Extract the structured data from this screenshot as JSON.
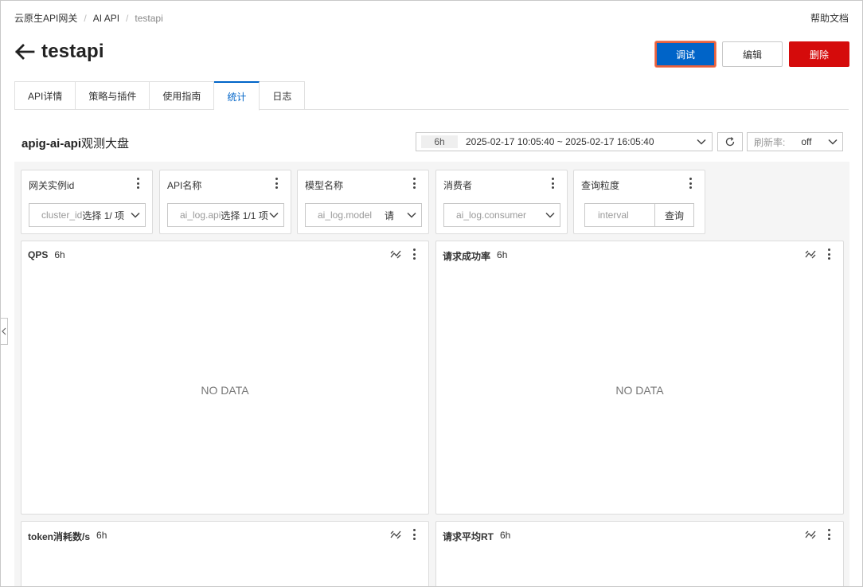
{
  "breadcrumb": {
    "items": [
      "云原生API网关",
      "AI API",
      "testapi"
    ],
    "separator": "/"
  },
  "help_link": "帮助文档",
  "page": {
    "title": "testapi",
    "back_icon": "arrow-left-icon"
  },
  "actions": {
    "debug": "调试",
    "edit": "编辑",
    "delete": "删除"
  },
  "tabs": [
    {
      "label": "API详情",
      "active": false
    },
    {
      "label": "策略与插件",
      "active": false
    },
    {
      "label": "使用指南",
      "active": false
    },
    {
      "label": "统计",
      "active": true
    },
    {
      "label": "日志",
      "active": false
    }
  ],
  "dashboard": {
    "title_bold": "apig-ai-api",
    "title_rest": "观测大盘",
    "time_badge": "6h",
    "time_range": "2025-02-17 10:05:40 ~ 2025-02-17 16:05:40",
    "refresh_label": "刷新率:",
    "refresh_value": "off"
  },
  "filters": [
    {
      "label": "网关实例id",
      "value": "cluster_id",
      "suffix": "选择 1/ 项"
    },
    {
      "label": "API名称",
      "value": "ai_log.api",
      "suffix": "选择 1/1 项"
    },
    {
      "label": "模型名称",
      "value": "ai_log.model",
      "suffix": "请"
    },
    {
      "label": "消费者",
      "value": "ai_log.consumer",
      "suffix": ""
    },
    {
      "label": "查询粒度",
      "placeholder": "interval",
      "button": "查询"
    }
  ],
  "panels": [
    {
      "title": "QPS",
      "range": "6h",
      "state": "NO DATA"
    },
    {
      "title": "请求成功率",
      "range": "6h",
      "state": "NO DATA"
    },
    {
      "title": "token消耗数/s",
      "range": "6h",
      "state": ""
    },
    {
      "title": "请求平均RT",
      "range": "6h",
      "state": ""
    }
  ],
  "colors": {
    "primary": "#0064c8",
    "danger": "#d50b0b",
    "highlight_border": "#e8603c"
  }
}
